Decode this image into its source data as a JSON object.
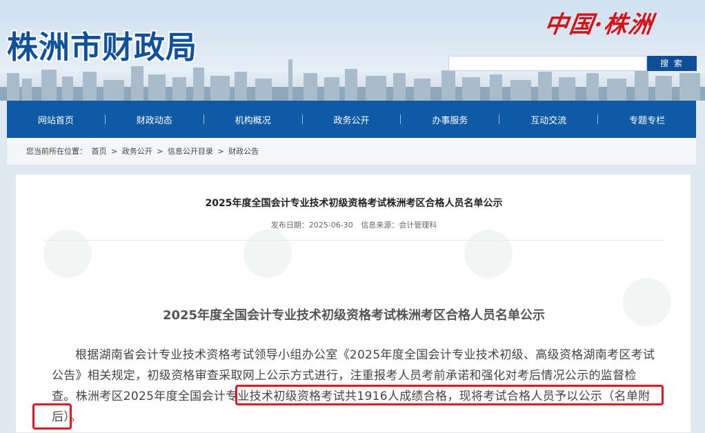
{
  "header": {
    "site_title": "株洲市财政局",
    "logo_text": "中国·株洲",
    "search_button": "搜 索",
    "search_placeholder": ""
  },
  "nav": {
    "items": [
      "网站首页",
      "财政动态",
      "机构概况",
      "政务公开",
      "办事服务",
      "互动交流",
      "专题专栏"
    ]
  },
  "breadcrumb": {
    "prefix": "您当前所在位置：",
    "items": [
      "首页",
      "政务公开",
      "信息公开目录",
      "财政公告"
    ],
    "sep": ">"
  },
  "article": {
    "title": "2025年度全国会计专业技术初级资格考试株洲考区合格人员名单公示",
    "publish_date": "发布日期：2025-06-30",
    "source": "信息来源：会计管理科",
    "body_title": "2025年度全国会计专业技术初级资格考试株洲考区合格人员名单公示",
    "paragraph": "根据湖南省会计专业技术资格考试领导小组办公室《2025年度全国会计专业技术初级、高级资格湖南考区考试公告》相关规定，初级资格审查采取网上公示方式进行，注重报考人员考前承诺和强化对考后情况公示的监督检查。株洲考区2025年度全国会计专业技术初级资格考试共1916人成绩合格，现将考试合格人员予以公示（名单附后）。"
  },
  "colors": {
    "brand_blue": "#0f5aa6",
    "title_blue": "#10519c",
    "highlight_red": "#e0161e"
  }
}
